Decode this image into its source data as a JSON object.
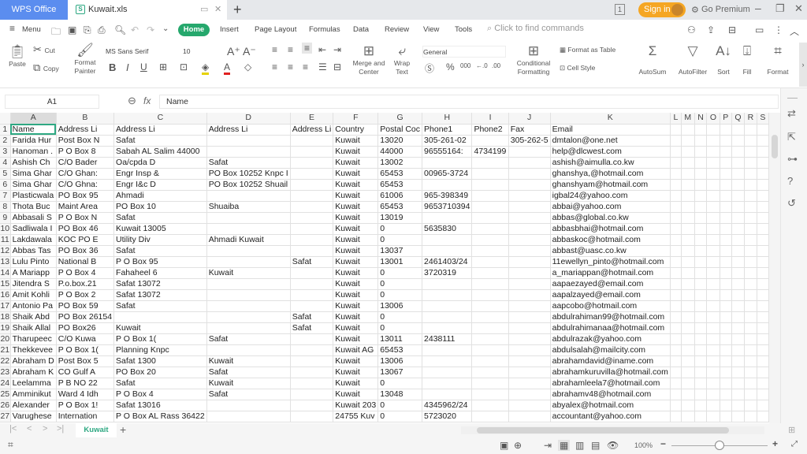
{
  "window": {
    "app_tab": "WPS Office",
    "doc_tab": "Kuwait.xls",
    "doc_icon": "S",
    "new_tab": "+",
    "page_count": "1",
    "sign_in": "Sign in",
    "go_premium": "Go Premium"
  },
  "menubar": {
    "menu": "Menu",
    "tabs": [
      "Home",
      "Insert",
      "Page Layout",
      "Formulas",
      "Data",
      "Review",
      "View",
      "Tools"
    ],
    "search_placeholder": "Click to find commands"
  },
  "ribbon": {
    "paste": "Paste",
    "cut": "Cut",
    "copy": "Copy",
    "format_painter_1": "Format",
    "format_painter_2": "Painter",
    "font_name": "MS Sans Serif",
    "font_size": "10",
    "merge_1": "Merge and",
    "merge_2": "Center",
    "wrap_1": "Wrap",
    "wrap_2": "Text",
    "number_format": "General",
    "cond_1": "Conditional",
    "cond_2": "Formatting",
    "format_as_table": "Format as Table",
    "cell_style": "Cell Style",
    "autosum": "AutoSum",
    "autofilter": "AutoFilter",
    "sort": "Sort",
    "fill": "Fill",
    "format": "Format"
  },
  "formula_bar": {
    "cell_ref": "A1",
    "fx": "fx",
    "value": "Name"
  },
  "sheet": {
    "columns": [
      "A",
      "B",
      "C",
      "D",
      "E",
      "F",
      "G",
      "H",
      "I",
      "J",
      "K",
      "L",
      "M",
      "N",
      "O",
      "P",
      "Q",
      "R",
      "S"
    ],
    "rows": [
      [
        "Name",
        "Address Li",
        "Address Li",
        "Address Li",
        "Address Li",
        "Country",
        "Postal Coc",
        "Phone1",
        "Phone2",
        "Fax",
        "Email"
      ],
      [
        "Farida Hur",
        "Post Box N",
        "Safat",
        "",
        "",
        "Kuwait",
        "13020",
        "305-261-02",
        "",
        "305-262-5",
        "dmtalon@one.net"
      ],
      [
        "Hanoman .",
        "P O Box 8",
        "Sabah AL Salim 44000",
        "",
        "",
        "Kuwait",
        "44000",
        "96555164:",
        "4734199",
        "",
        "help@dlcwest.com"
      ],
      [
        "Ashish Ch",
        "C/O Bader",
        "Oa/cpda D",
        "Safat",
        "",
        "Kuwait",
        "13002",
        "",
        "",
        "",
        "ashish@aimulla.co.kw"
      ],
      [
        "Sima Ghar",
        "C/O Ghan:",
        "Engr Insp &",
        "PO Box 10252 Knpc I",
        "",
        "Kuwait",
        "65453",
        "00965-3724",
        "",
        "",
        "ghanshya,@hotmail.com"
      ],
      [
        "Sima Ghar",
        "C/O Ghna:",
        "Engr I&c D",
        "PO Box 10252 Shuail",
        "",
        "Kuwait",
        "65453",
        "",
        "",
        "",
        "ghanshyam@hotmail.com"
      ],
      [
        "Plasticwala",
        "PO Box 95",
        "Ahmadi",
        "",
        "",
        "Kuwait",
        "61006",
        "965-398349",
        "",
        "",
        "igbal24@yahoo.com"
      ],
      [
        "Thota Buc",
        "Maint Area",
        "PO Box 10",
        "Shuaiba",
        "",
        "Kuwait",
        "65453",
        "9653710394",
        "",
        "",
        "abbai@yahoo.com"
      ],
      [
        "Abbasali S",
        "P O Box N",
        "Safat",
        "",
        "",
        "Kuwait",
        "13019",
        "",
        "",
        "",
        "abbas@global.co.kw"
      ],
      [
        "Sadliwala I",
        "PO Box 46",
        "Kuwait 13005",
        "",
        "",
        "Kuwait",
        "0",
        "5635830",
        "",
        "",
        "abbasbhai@hotmail.com"
      ],
      [
        "Lakdawala",
        "KOC PO E",
        "Utility Div",
        "Ahmadi Kuwait",
        "",
        "Kuwait",
        "0",
        "",
        "",
        "",
        "abbaskoc@hotmail.com"
      ],
      [
        "Abbas Tas",
        "PO Box 36",
        "Safat",
        "",
        "",
        "Kuwait",
        "13037",
        "",
        "",
        "",
        "abbast@uasc.co.kw"
      ],
      [
        "Lulu Pinto",
        "National B",
        "P O Box 95",
        "",
        "Safat",
        "Kuwait",
        "13001",
        "2461403/24",
        "",
        "",
        "11ewellyn_pinto@hotmail.com"
      ],
      [
        "A Mariapp",
        "P O Box 4",
        "Fahaheel 6",
        "Kuwait",
        "",
        "Kuwait",
        "0",
        "3720319",
        "",
        "",
        "a_mariappan@hotmail.com"
      ],
      [
        "Jitendra S",
        "P.o.box.21",
        "Safat 13072",
        "",
        "",
        "Kuwait",
        "0",
        "",
        "",
        "",
        "aapaezayed@email.com"
      ],
      [
        "Amit Kohli",
        "P O Box 2",
        "Safat 13072",
        "",
        "",
        "Kuwait",
        "0",
        "",
        "",
        "",
        "aapalzayed@email.com"
      ],
      [
        "Antonio Pa",
        "PO Box 59",
        "Safat",
        "",
        "",
        "Kuwait",
        "13006",
        "",
        "",
        "",
        "aapcobo@hotmail.com"
      ],
      [
        "Shaik Abd",
        "PO Box 26154",
        "",
        "",
        "Safat",
        "Kuwait",
        "0",
        "",
        "",
        "",
        "abdulrahiman99@hotmail.com"
      ],
      [
        "Shaik Allal",
        "PO Box26",
        "Kuwait",
        "",
        "Safat",
        "Kuwait",
        "0",
        "",
        "",
        "",
        "abdulrahimanaa@hotmail.com"
      ],
      [
        "Tharupeec",
        "C/O Kuwa",
        "P O Box 1(",
        "Safat",
        "",
        "Kuwait",
        "13011",
        "2438111",
        "",
        "",
        "abdulrazak@yahoo.com"
      ],
      [
        "Thekkevee",
        "P O Box 1(",
        "Planning Knpc",
        "",
        "",
        "Kuwait AG",
        "65453",
        "",
        "",
        "",
        "abdulsalah@mailcity.com"
      ],
      [
        "Abraham D",
        "Post Box 5",
        "Safat 1300",
        "Kuwait",
        "",
        "Kuwait",
        "13006",
        "",
        "",
        "",
        "abrahamdavid@iname.com"
      ],
      [
        "Abraham K",
        "CO Gulf A",
        "PO Box 20",
        "Safat",
        "",
        "Kuwait",
        "13067",
        "",
        "",
        "",
        "abrahamkuruvilla@hotmail.com"
      ],
      [
        "Leelamma",
        "P B NO 22",
        "Safat",
        "Kuwait",
        "",
        "Kuwait",
        "0",
        "",
        "",
        "",
        "abrahamleela7@hotmail.com"
      ],
      [
        "Amminikut",
        "Ward 4 Idh",
        "P O Box 4",
        "Safat",
        "",
        "Kuwait",
        "13048",
        "",
        "",
        "",
        "abrahamv48@hotmail.com"
      ],
      [
        "Alexander",
        "P O Box 1!",
        "Safat 13016",
        "",
        "",
        "Kuwait 203",
        "0",
        "4345962/24",
        "",
        "",
        "abyalex@hotmail.com"
      ],
      [
        "Varughese",
        "Internation",
        "P O Box AL Rass 36422",
        "",
        "",
        "24755 Kuv",
        "0",
        "5723020",
        "",
        "",
        "accountant@yahoo.com"
      ]
    ]
  },
  "sheet_tabs": {
    "active": "Kuwait",
    "add": "+"
  },
  "status": {
    "zoom_level": "100%",
    "zoom_fraction": 0.5
  }
}
